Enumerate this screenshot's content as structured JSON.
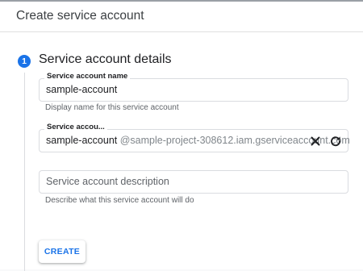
{
  "header": {
    "title": "Create service account"
  },
  "step": {
    "number": "1",
    "title": "Service account details",
    "accent_color": "#1a73e8"
  },
  "fields": {
    "name": {
      "label": "Service account name",
      "value": "sample-account",
      "helper": "Display name for this service account"
    },
    "id": {
      "label": "Service accou...",
      "value": "sample-account",
      "suffix": "@sample-project-308612.iam.gserviceaccount.com",
      "clear_icon": "close-icon",
      "refresh_icon": "refresh-icon"
    },
    "description": {
      "placeholder": "Service account description",
      "helper": "Describe what this service account will do"
    }
  },
  "actions": {
    "create_label": "CREATE"
  }
}
